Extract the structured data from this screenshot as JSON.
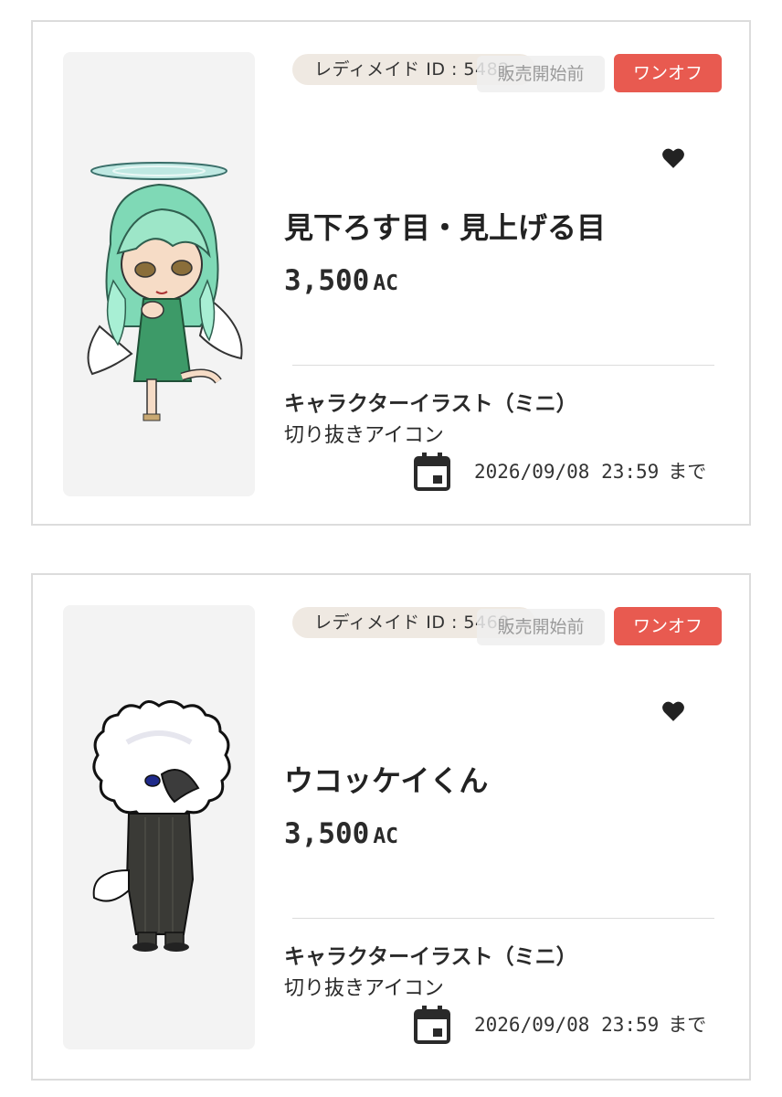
{
  "listings": [
    {
      "id_label": "レディメイド ID : 5482",
      "status": "販売開始前",
      "type_badge": "ワンオフ",
      "title": "見下ろす目・見上げる目",
      "price": "3,500",
      "currency": "AC",
      "category": "キャラクターイラスト（ミニ）",
      "subcategory": "切り抜きアイコン",
      "deadline": "2026/09/08 23:59",
      "deadline_suffix": "まで"
    },
    {
      "id_label": "レディメイド ID : 5460",
      "status": "販売開始前",
      "type_badge": "ワンオフ",
      "title": "ウコッケイくん",
      "price": "3,500",
      "currency": "AC",
      "category": "キャラクターイラスト（ミニ）",
      "subcategory": "切り抜きアイコン",
      "deadline": "2026/09/08 23:59",
      "deadline_suffix": "まで"
    }
  ],
  "colors": {
    "badge_red": "#e85a50",
    "id_pill_bg": "#efe9e2",
    "thumb_bg": "#f3f3f3",
    "border": "#dcdcdc"
  },
  "icons": [
    "heart-icon",
    "calendar-icon"
  ]
}
